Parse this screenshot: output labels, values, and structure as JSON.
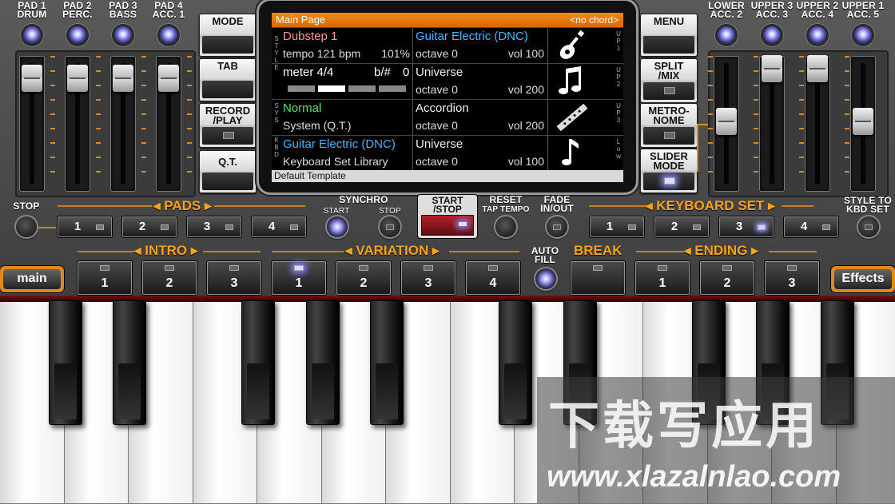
{
  "top_left_pads": [
    {
      "line1": "PAD 1",
      "line2": "DRUM"
    },
    {
      "line1": "PAD 2",
      "line2": "PERC."
    },
    {
      "line1": "PAD 3",
      "line2": "BASS"
    },
    {
      "line1": "PAD 4",
      "line2": "ACC. 1"
    }
  ],
  "top_right_parts": [
    {
      "line1": "LOWER",
      "line2": "ACC. 2"
    },
    {
      "line1": "UPPER 3",
      "line2": "ACC. 3"
    },
    {
      "line1": "UPPER 2",
      "line2": "ACC. 4"
    },
    {
      "line1": "UPPER 1",
      "line2": "ACC. 5"
    }
  ],
  "left_buttons": {
    "mode": "MODE",
    "tab": "TAB",
    "record_l1": "RECORD",
    "record_l2": "/PLAY",
    "qt": "Q.T."
  },
  "right_buttons": {
    "menu": "MENU",
    "split_l1": "SPLIT",
    "split_l2": "/MIX",
    "metro_l1": "METRO-",
    "metro_l2": "NOME",
    "slider_l1": "SLIDER",
    "slider_l2": "MODE"
  },
  "screen": {
    "title": "Main Page",
    "chord": "<no chord>",
    "style_name": "Dubstep 1",
    "tempo": "tempo 121 bpm",
    "tempo_pct": "101%",
    "meter": "meter 4/4",
    "transpose": "b/#",
    "transpose_val": "0",
    "sys_name": "Normal",
    "sys_sub": "System (Q.T.)",
    "kbd_name": "Guitar Electric (DNC)",
    "kbd_sub": "Keyboard Set Library",
    "footer": "Default Template",
    "side_style": "STYLE",
    "side_sys": "SYS",
    "side_kbd": "KBD",
    "parts": [
      {
        "name": "Guitar Electric (DNC)",
        "octave": "octave  0",
        "vol": "vol 100",
        "tag": "UP1",
        "icon": "guitar-icon",
        "highlight": true
      },
      {
        "name": "Universe",
        "octave": "octave  0",
        "vol": "vol 200",
        "tag": "UP2",
        "icon": "music-note-icon",
        "highlight": false
      },
      {
        "name": "Accordion",
        "octave": "octave  0",
        "vol": "vol 200",
        "tag": "UP3",
        "icon": "flute-icon",
        "highlight": false
      },
      {
        "name": "Universe",
        "octave": "octave  0",
        "vol": "vol 100",
        "tag": "Low",
        "icon": "music-note-icon",
        "highlight": false
      }
    ]
  },
  "row1": {
    "stop": "STOP",
    "pads": "PADS",
    "pad_nums": [
      "1",
      "2",
      "3",
      "4"
    ],
    "synchro": "SYNCHRO",
    "synchro_start": "START",
    "synchro_stop": "STOP",
    "start_stop_l1": "START",
    "start_stop_l2": "/STOP",
    "reset_l1": "RESET",
    "reset_l2": "TAP TEMPO",
    "fade_l1": "FADE",
    "fade_l2": "IN/OUT",
    "keyboard_set": "KEYBOARD SET",
    "kbd_nums": [
      "1",
      "2",
      "3",
      "4"
    ],
    "style_to_l1": "STYLE TO",
    "style_to_l2": "KBD SET"
  },
  "row2": {
    "intro": "INTRO",
    "intro_nums": [
      "1",
      "2",
      "3"
    ],
    "variation": "VARIATION",
    "var_nums": [
      "1",
      "2",
      "3",
      "4"
    ],
    "auto_fill_l1": "AUTO",
    "auto_fill_l2": "FILL",
    "break": "BREAK",
    "ending": "ENDING",
    "ending_nums": [
      "1",
      "2",
      "3"
    ],
    "main": "main",
    "effects": "Effects"
  },
  "watermark": {
    "cn": "下载写应用",
    "url": "www.xlazalnlao.com"
  },
  "colors": {
    "accent": "#f08a1a",
    "section": "#ffa319",
    "screen_bg": "#000000",
    "style_name": "#ff9a9a",
    "part_name": "#4ab4ff",
    "sys_name": "#55e27a"
  }
}
